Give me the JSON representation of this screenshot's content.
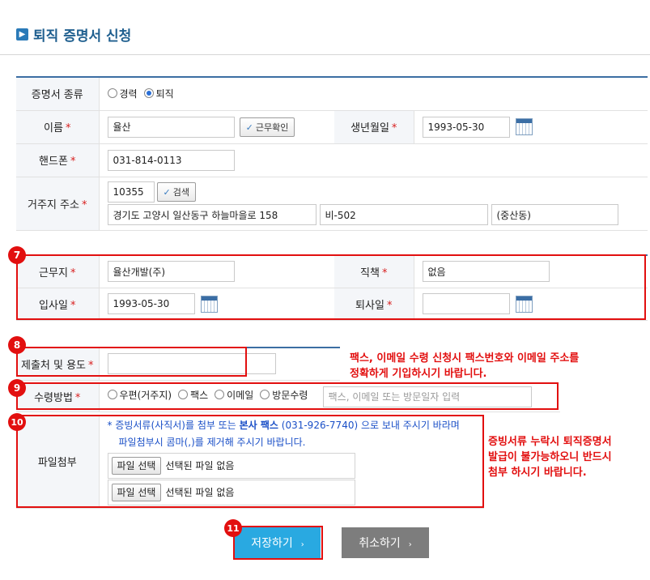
{
  "page": {
    "title": "퇴직 증명서 신청",
    "title_marker": "▶"
  },
  "section1": {
    "cert_type_label": "증명서 종류",
    "cert_type_options": [
      "경력",
      "퇴직"
    ],
    "cert_type_selected": "퇴직",
    "name_label": "이름",
    "name_value": "율산",
    "verify_button": "근무확인",
    "birth_label": "생년월일",
    "birth_value": "1993-05-30",
    "phone_label": "핸드폰",
    "phone_value": "031-814-0113",
    "address_label": "거주지 주소",
    "zip_value": "10355",
    "search_button": "검색",
    "address1": "경기도 고양시 일산동구 하늘마을로 158",
    "address2": "비-502",
    "address3": "(중산동)"
  },
  "section7": {
    "badge": "7",
    "workplace_label": "근무지",
    "workplace_value": "율산개발(주)",
    "position_label": "직책",
    "position_value": "없음",
    "join_label": "입사일",
    "join_value": "1993-05-30",
    "leave_label": "퇴사일",
    "leave_value": ""
  },
  "section8": {
    "badge": "8",
    "purpose_label": "제출처 및 용도",
    "purpose_value": "",
    "note_line1": "팩스, 이메일 수령 신청시 팩스번호와 이메일 주소를",
    "note_line2": "정확하게 기입하시기 바랍니다."
  },
  "section9": {
    "badge": "9",
    "method_label": "수령방법",
    "method_options": [
      "우편(거주지)",
      "팩스",
      "이메일",
      "방문수령"
    ],
    "method_placeholder": "팩스, 이메일 또는 방문일자 입력"
  },
  "section10": {
    "badge": "10",
    "file_label": "파일첨부",
    "hint_prefix": "* 증빙서류(사직서)를 첨부 또는 ",
    "hint_bold": "본사 팩스",
    "hint_suffix": " (031-926-7740) 으로 보내 주시기 바라며",
    "hint_line2": "파일첨부시 콤마(,)를 제거해 주시기 바랍니다.",
    "file_button": "파일 선택",
    "file_status": "선택된 파일 없음",
    "note_line1": "증빙서류 누락시 퇴직증명서",
    "note_line2": "발급이 불가능하오니 반드시",
    "note_line3": "첨부 하시기 바랍니다."
  },
  "actions": {
    "badge": "11",
    "save_label": "저장하기",
    "cancel_label": "취소하기",
    "arrow": "›"
  },
  "colors": {
    "accent": "#29a9e1",
    "highlight": "#e20f0f",
    "header_blue": "#1f5f8f"
  }
}
